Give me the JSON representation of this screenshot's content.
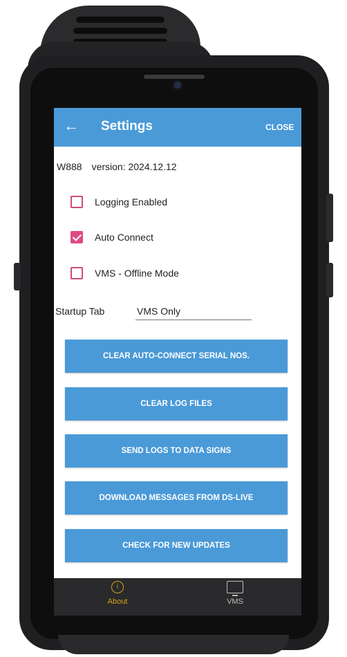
{
  "appbar": {
    "title": "Settings",
    "close_label": "CLOSE",
    "back_icon": "arrow-left-icon",
    "color": "#4a9ad8"
  },
  "version": {
    "model": "W888",
    "text": "version: 2024.12.12"
  },
  "checkboxes": [
    {
      "label": "Logging Enabled",
      "checked": false
    },
    {
      "label": "Auto Connect",
      "checked": true
    },
    {
      "label": "VMS - Offline Mode",
      "checked": false
    }
  ],
  "checkbox_color": "#e04a84",
  "startup": {
    "label": "Startup Tab",
    "value": "VMS Only"
  },
  "buttons": [
    "CLEAR AUTO-CONNECT SERIAL NOS.",
    "CLEAR LOG FILES",
    "SEND LOGS TO DATA SIGNS",
    "DOWNLOAD MESSAGES FROM DS-LIVE",
    "CHECK FOR NEW UPDATES"
  ],
  "nav": {
    "items": [
      {
        "label": "About",
        "icon": "info-circle-icon",
        "active": true,
        "color": "#d7a21a"
      },
      {
        "label": "VMS",
        "icon": "monitor-icon",
        "active": false,
        "color": "#bdbdbd"
      }
    ]
  }
}
